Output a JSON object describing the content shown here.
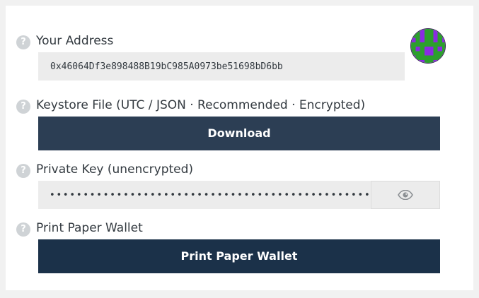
{
  "address": {
    "label": "Your Address",
    "value": "0x46064Df3e898488B19bC985A0973be51698bD6bb",
    "help_icon": "question-circle-icon",
    "identicon_colors": [
      "#8a2be2",
      "#2ca02c"
    ]
  },
  "keystore": {
    "label": "Keystore File (UTC / JSON · Recommended · Encrypted)",
    "button_label": "Download",
    "help_icon": "question-circle-icon"
  },
  "private_key": {
    "label": "Private Key (unencrypted)",
    "masked_value": "••••••••••••••••••••••••••••••••••••••••••••••••",
    "toggle_icon": "eye-icon",
    "help_icon": "question-circle-icon"
  },
  "paper_wallet": {
    "label": "Print Paper Wallet",
    "button_label": "Print Paper Wallet",
    "help_icon": "question-circle-icon"
  },
  "help_glyph": "?",
  "colors": {
    "button_primary": "#2c3e54",
    "button_dark": "#1b3149",
    "field_bg": "#ececec",
    "help_icon_bg": "#cfd3d6"
  }
}
